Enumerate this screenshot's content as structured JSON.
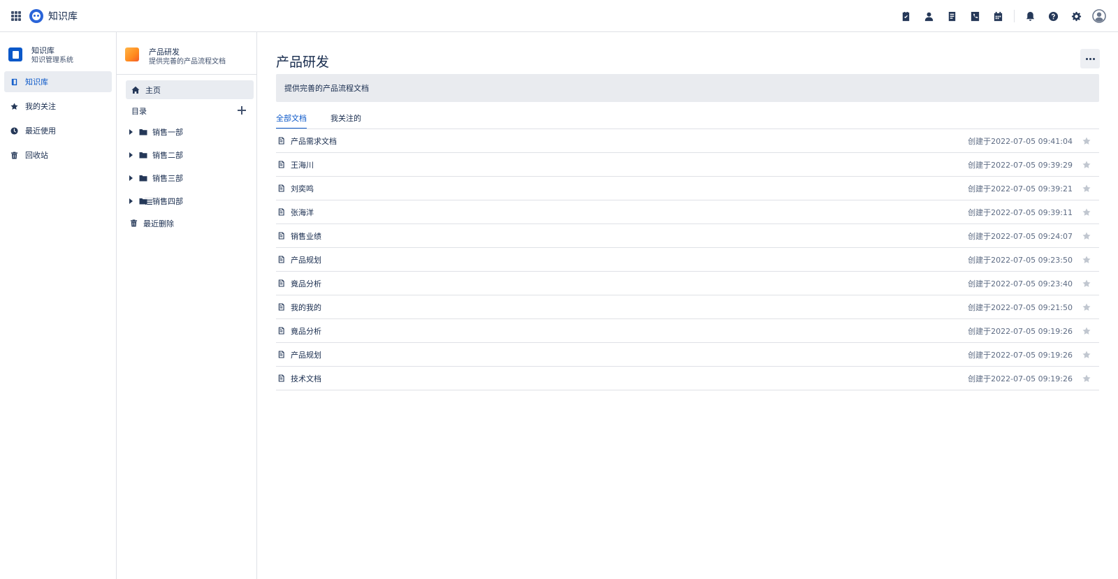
{
  "topbar": {
    "app_title": "知识库",
    "icons": [
      "apps-grid-icon",
      "logo-icon",
      "task-icon",
      "user-icon",
      "document-icon",
      "phone-icon",
      "calendar-icon",
      "bell-icon",
      "help-icon",
      "gear-icon",
      "avatar-icon"
    ]
  },
  "sidebar": {
    "space_title": "知识库",
    "space_subtitle": "知识管理系统",
    "items": [
      {
        "label": "知识库",
        "icon": "book-icon",
        "active": true
      },
      {
        "label": "我的关注",
        "icon": "star-icon",
        "active": false
      },
      {
        "label": "最近使用",
        "icon": "clock-icon",
        "active": false
      },
      {
        "label": "回收站",
        "icon": "trash-icon",
        "active": false
      }
    ]
  },
  "tree": {
    "title": "产品研发",
    "subtitle": "提供完善的产品流程文档",
    "home_label": "主页",
    "toc_label": "目录",
    "folders": [
      "销售一部",
      "销售二部",
      "销售三部",
      "销售四部"
    ],
    "deleted_label": "最近删除"
  },
  "main": {
    "title": "产品研发",
    "description": "提供完善的产品流程文档",
    "tabs": [
      {
        "label": "全部文档",
        "active": true
      },
      {
        "label": "我关注的",
        "active": false
      }
    ],
    "documents": [
      {
        "name": "产品需求文档",
        "created": "创建于2022-07-05 09:41:04"
      },
      {
        "name": "王海川",
        "created": "创建于2022-07-05 09:39:29"
      },
      {
        "name": "刘奕鸣",
        "created": "创建于2022-07-05 09:39:21"
      },
      {
        "name": "张海洋",
        "created": "创建于2022-07-05 09:39:11"
      },
      {
        "name": "销售业绩",
        "created": "创建于2022-07-05 09:24:07"
      },
      {
        "name": "产品规划",
        "created": "创建于2022-07-05 09:23:50"
      },
      {
        "name": "竟品分析",
        "created": "创建于2022-07-05 09:23:40"
      },
      {
        "name": "我的我的",
        "created": "创建于2022-07-05 09:21:50"
      },
      {
        "name": "竟品分析",
        "created": "创建于2022-07-05 09:19:26"
      },
      {
        "name": "产品规划",
        "created": "创建于2022-07-05 09:19:26"
      },
      {
        "name": "技术文档",
        "created": "创建于2022-07-05 09:19:26"
      }
    ]
  },
  "colors": {
    "accent": "#0b58c9",
    "text": "#172b4d",
    "muted": "#5e6c84",
    "border": "#dfe1e6",
    "active_bg": "#e9ecf1"
  }
}
